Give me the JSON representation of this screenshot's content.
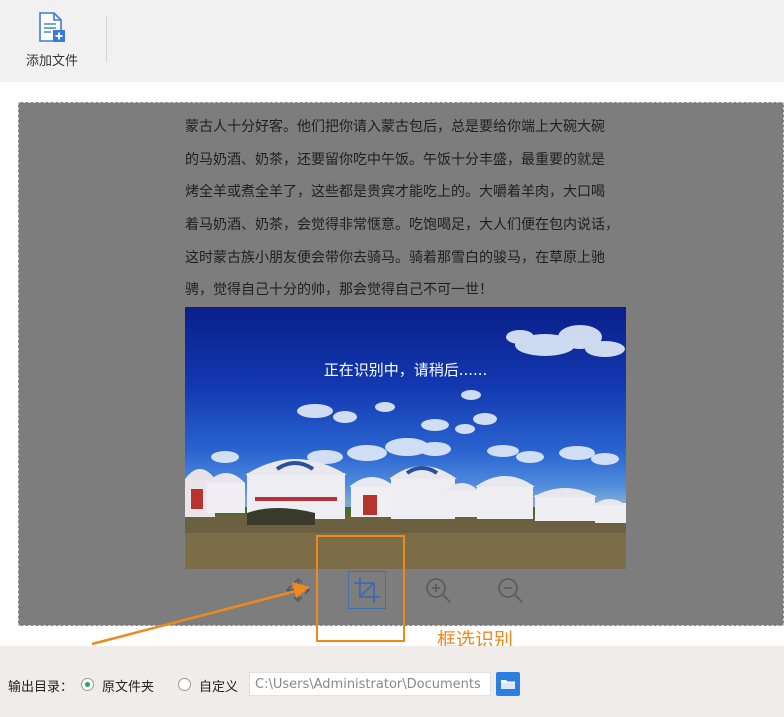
{
  "toolbar": {
    "add_file_label": "添加文件"
  },
  "document": {
    "lines": [
      "蒙古人十分好客。他们把你请入蒙古包后，总是要给你端上大碗大碗",
      "的马奶酒、奶茶，还要留你吃中午饭。午饭十分丰盛，最重要的就是",
      "烤全羊或煮全羊了，这些都是贵宾才能吃上的。大嚼着羊肉，大口喝",
      "着马奶酒、奶茶，会觉得非常惬意。吃饱喝足，大人们便在包内说话，",
      "这时蒙古族小朋友便会带你去骑马。骑着那雪白的骏马，在草原上驰",
      "骋，觉得自己十分的帅，那会觉得自己不可一世！"
    ],
    "recognition_status": "正在识别中，请稍后......"
  },
  "controls": {
    "move_icon": "move-icon",
    "crop_icon": "crop-icon",
    "zoom_in_icon": "zoom-in-icon",
    "zoom_out_icon": "zoom-out-icon"
  },
  "callout": {
    "label": "框选识别",
    "color": "#ee8a1d"
  },
  "output": {
    "label": "输出目录：",
    "option_original": "原文件夹",
    "option_custom": "自定义",
    "selected": "original",
    "path_value": "C:\\Users\\Administrator\\Documents",
    "accent": "#1aad5a"
  }
}
